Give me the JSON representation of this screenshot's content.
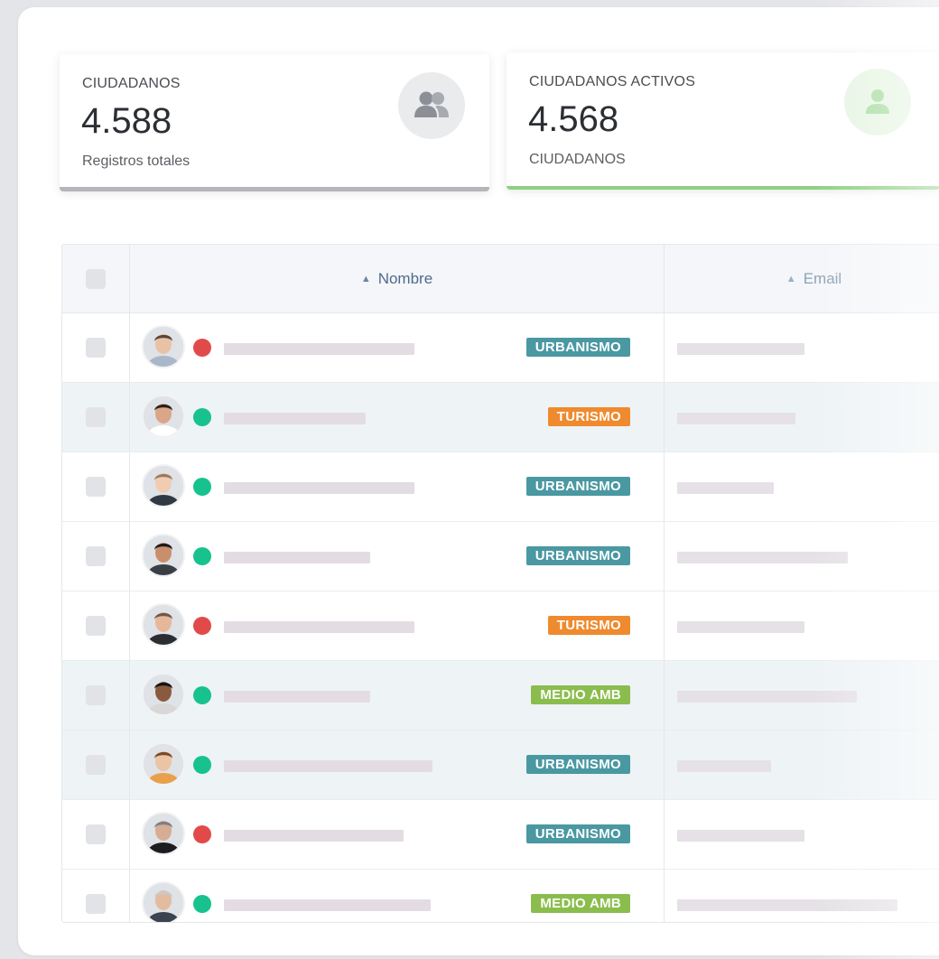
{
  "stats": {
    "total": {
      "title": "CIUDADANOS",
      "value": "4.588",
      "subtitle": "Registros totales",
      "icon": "users-icon",
      "accent": "#b5b6b9"
    },
    "active": {
      "title": "CIUDADANOS ACTIVOS",
      "value": "4.568",
      "subtitle": "CIUDADANOS",
      "icon": "user-icon",
      "accent": "#8bd27f"
    }
  },
  "table": {
    "columns": {
      "name": "Nombre",
      "email": "Email"
    },
    "tag_colors": {
      "URBANISMO": "#4a98a2",
      "TURISMO": "#ef8a2e",
      "MEDIO AMB": "#8bbd4e"
    },
    "status_colors": {
      "active": "#17c28e",
      "inactive": "#e24a4a"
    },
    "rows": [
      {
        "status": "inactive",
        "department": "URBANISMO",
        "avatar": "man-short-hair"
      },
      {
        "status": "active",
        "department": "TURISMO",
        "avatar": "woman-long-hair"
      },
      {
        "status": "active",
        "department": "URBANISMO",
        "avatar": "man-beard"
      },
      {
        "status": "active",
        "department": "URBANISMO",
        "avatar": "woman-curly-hair"
      },
      {
        "status": "inactive",
        "department": "TURISMO",
        "avatar": "man-glasses"
      },
      {
        "status": "active",
        "department": "MEDIO AMB",
        "avatar": "woman-dark-hair"
      },
      {
        "status": "active",
        "department": "URBANISMO",
        "avatar": "man-curly-hair"
      },
      {
        "status": "inactive",
        "department": "URBANISMO",
        "avatar": "woman-short-hair"
      },
      {
        "status": "active",
        "department": "MEDIO AMB",
        "avatar": "older-man-beard"
      }
    ]
  }
}
